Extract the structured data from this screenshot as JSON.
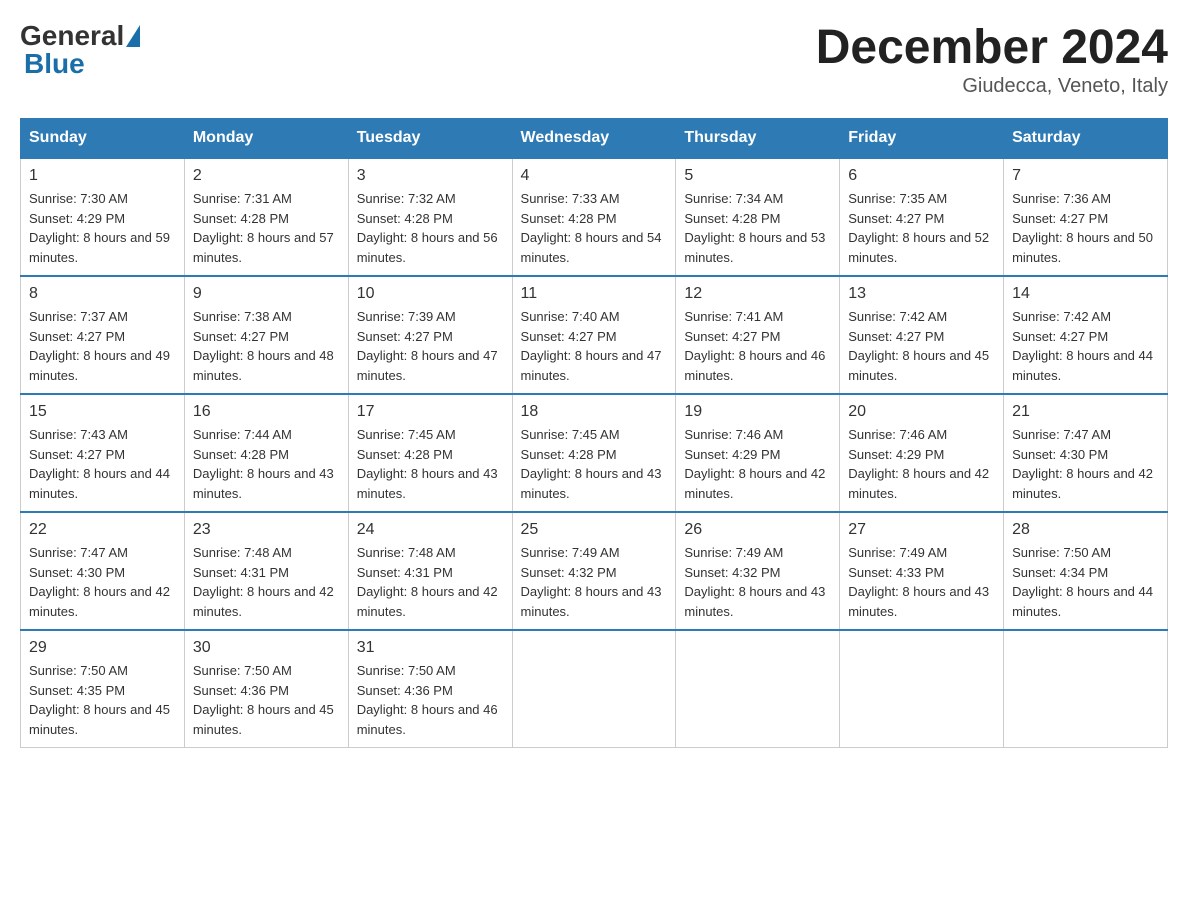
{
  "header": {
    "logo_general": "General",
    "logo_blue": "Blue",
    "month_year": "December 2024",
    "location": "Giudecca, Veneto, Italy"
  },
  "weekdays": [
    "Sunday",
    "Monday",
    "Tuesday",
    "Wednesday",
    "Thursday",
    "Friday",
    "Saturday"
  ],
  "weeks": [
    [
      {
        "day": "1",
        "sunrise": "7:30 AM",
        "sunset": "4:29 PM",
        "daylight": "8 hours and 59 minutes."
      },
      {
        "day": "2",
        "sunrise": "7:31 AM",
        "sunset": "4:28 PM",
        "daylight": "8 hours and 57 minutes."
      },
      {
        "day": "3",
        "sunrise": "7:32 AM",
        "sunset": "4:28 PM",
        "daylight": "8 hours and 56 minutes."
      },
      {
        "day": "4",
        "sunrise": "7:33 AM",
        "sunset": "4:28 PM",
        "daylight": "8 hours and 54 minutes."
      },
      {
        "day": "5",
        "sunrise": "7:34 AM",
        "sunset": "4:28 PM",
        "daylight": "8 hours and 53 minutes."
      },
      {
        "day": "6",
        "sunrise": "7:35 AM",
        "sunset": "4:27 PM",
        "daylight": "8 hours and 52 minutes."
      },
      {
        "day": "7",
        "sunrise": "7:36 AM",
        "sunset": "4:27 PM",
        "daylight": "8 hours and 50 minutes."
      }
    ],
    [
      {
        "day": "8",
        "sunrise": "7:37 AM",
        "sunset": "4:27 PM",
        "daylight": "8 hours and 49 minutes."
      },
      {
        "day": "9",
        "sunrise": "7:38 AM",
        "sunset": "4:27 PM",
        "daylight": "8 hours and 48 minutes."
      },
      {
        "day": "10",
        "sunrise": "7:39 AM",
        "sunset": "4:27 PM",
        "daylight": "8 hours and 47 minutes."
      },
      {
        "day": "11",
        "sunrise": "7:40 AM",
        "sunset": "4:27 PM",
        "daylight": "8 hours and 47 minutes."
      },
      {
        "day": "12",
        "sunrise": "7:41 AM",
        "sunset": "4:27 PM",
        "daylight": "8 hours and 46 minutes."
      },
      {
        "day": "13",
        "sunrise": "7:42 AM",
        "sunset": "4:27 PM",
        "daylight": "8 hours and 45 minutes."
      },
      {
        "day": "14",
        "sunrise": "7:42 AM",
        "sunset": "4:27 PM",
        "daylight": "8 hours and 44 minutes."
      }
    ],
    [
      {
        "day": "15",
        "sunrise": "7:43 AM",
        "sunset": "4:27 PM",
        "daylight": "8 hours and 44 minutes."
      },
      {
        "day": "16",
        "sunrise": "7:44 AM",
        "sunset": "4:28 PM",
        "daylight": "8 hours and 43 minutes."
      },
      {
        "day": "17",
        "sunrise": "7:45 AM",
        "sunset": "4:28 PM",
        "daylight": "8 hours and 43 minutes."
      },
      {
        "day": "18",
        "sunrise": "7:45 AM",
        "sunset": "4:28 PM",
        "daylight": "8 hours and 43 minutes."
      },
      {
        "day": "19",
        "sunrise": "7:46 AM",
        "sunset": "4:29 PM",
        "daylight": "8 hours and 42 minutes."
      },
      {
        "day": "20",
        "sunrise": "7:46 AM",
        "sunset": "4:29 PM",
        "daylight": "8 hours and 42 minutes."
      },
      {
        "day": "21",
        "sunrise": "7:47 AM",
        "sunset": "4:30 PM",
        "daylight": "8 hours and 42 minutes."
      }
    ],
    [
      {
        "day": "22",
        "sunrise": "7:47 AM",
        "sunset": "4:30 PM",
        "daylight": "8 hours and 42 minutes."
      },
      {
        "day": "23",
        "sunrise": "7:48 AM",
        "sunset": "4:31 PM",
        "daylight": "8 hours and 42 minutes."
      },
      {
        "day": "24",
        "sunrise": "7:48 AM",
        "sunset": "4:31 PM",
        "daylight": "8 hours and 42 minutes."
      },
      {
        "day": "25",
        "sunrise": "7:49 AM",
        "sunset": "4:32 PM",
        "daylight": "8 hours and 43 minutes."
      },
      {
        "day": "26",
        "sunrise": "7:49 AM",
        "sunset": "4:32 PM",
        "daylight": "8 hours and 43 minutes."
      },
      {
        "day": "27",
        "sunrise": "7:49 AM",
        "sunset": "4:33 PM",
        "daylight": "8 hours and 43 minutes."
      },
      {
        "day": "28",
        "sunrise": "7:50 AM",
        "sunset": "4:34 PM",
        "daylight": "8 hours and 44 minutes."
      }
    ],
    [
      {
        "day": "29",
        "sunrise": "7:50 AM",
        "sunset": "4:35 PM",
        "daylight": "8 hours and 45 minutes."
      },
      {
        "day": "30",
        "sunrise": "7:50 AM",
        "sunset": "4:36 PM",
        "daylight": "8 hours and 45 minutes."
      },
      {
        "day": "31",
        "sunrise": "7:50 AM",
        "sunset": "4:36 PM",
        "daylight": "8 hours and 46 minutes."
      },
      null,
      null,
      null,
      null
    ]
  ],
  "labels": {
    "sunrise": "Sunrise:",
    "sunset": "Sunset:",
    "daylight": "Daylight:"
  }
}
